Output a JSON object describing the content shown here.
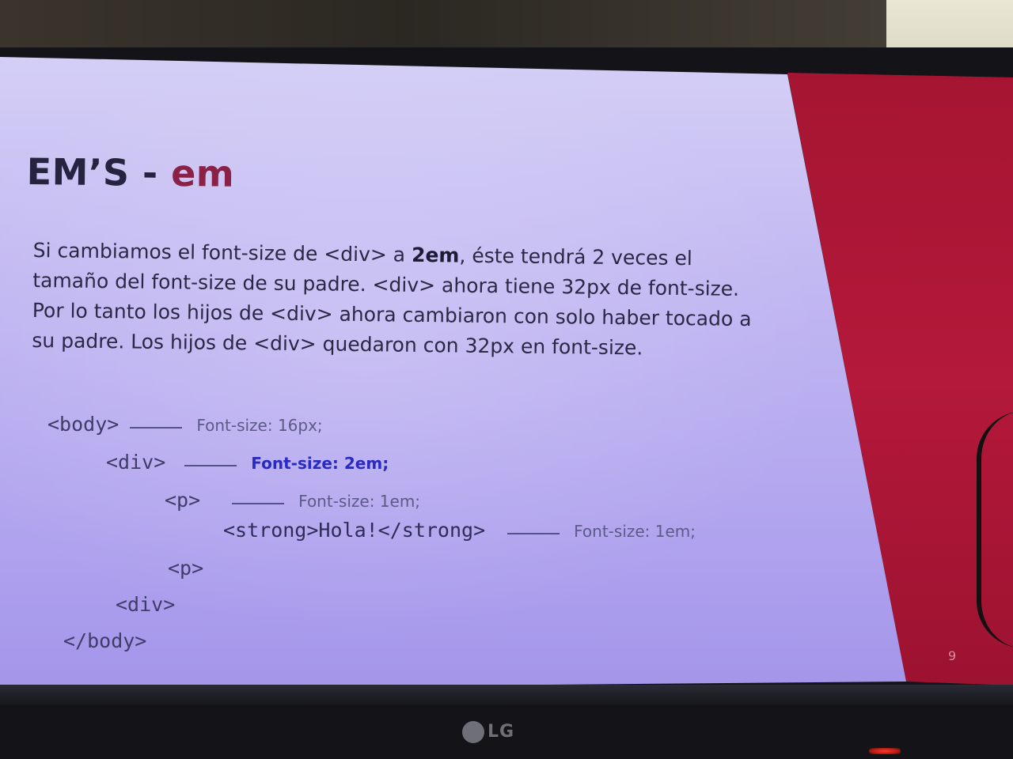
{
  "slide": {
    "title_main": "EM’S - ",
    "title_accent": "em",
    "paragraph": {
      "part1": "Si cambiamos el font-size de <div> a ",
      "bold": "2em",
      "part2": ", éste tendrá 2 veces el tamaño del font-size de su padre. <div> ahora tiene 32px de font-size. Por lo tanto los hijos de <div> ahora cambiaron con solo haber tocado a su padre. Los hijos de <div> quedaron con 32px en font-size."
    },
    "code": {
      "body_open": "<body>",
      "body_note": "Font-size: 16px;",
      "div_open": "<div>",
      "div_note": "Font-size: 2em;",
      "p_open": "<p>",
      "p_note": "Font-size: 1em;",
      "strong_line": "<strong>Hola!</strong>",
      "strong_note": "Font-size: 1em;",
      "p_close": "<p>",
      "div_close": "<div>",
      "body_close": "</body>"
    },
    "page_number": "9"
  },
  "monitor": {
    "brand": "LG"
  },
  "colors": {
    "slide_bg": "#c2b8f2",
    "accent": "#8a2146",
    "highlight": "#2a2ac0",
    "red_panel": "#b4183a"
  }
}
